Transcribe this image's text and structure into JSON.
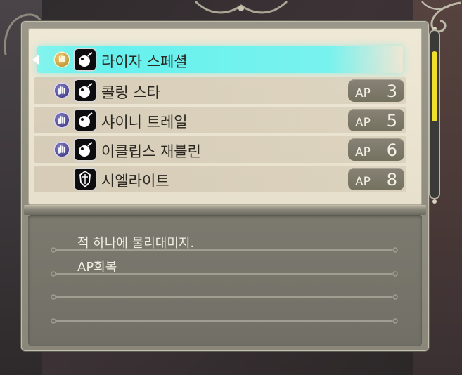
{
  "skills": [
    {
      "type": "fist",
      "type_icon": "fist-icon",
      "icon": "bomb-icon",
      "name": "라이자 스페셜",
      "ap_label": "",
      "ap": "",
      "selected": true
    },
    {
      "type": "magic",
      "type_icon": "magic-hand-icon",
      "icon": "bomb-icon",
      "name": "콜링 스타",
      "ap_label": "AP",
      "ap": "3",
      "selected": false
    },
    {
      "type": "magic",
      "type_icon": "magic-hand-icon",
      "icon": "bomb-icon",
      "name": "샤이니 트레일",
      "ap_label": "AP",
      "ap": "5",
      "selected": false
    },
    {
      "type": "magic",
      "type_icon": "magic-hand-icon",
      "icon": "bomb-icon",
      "name": "이클립스 재블린",
      "ap_label": "AP",
      "ap": "6",
      "selected": false
    },
    {
      "type": "none",
      "type_icon": "",
      "icon": "armor-icon",
      "name": "시엘라이트",
      "ap_label": "AP",
      "ap": "8",
      "selected": false
    }
  ],
  "description": {
    "lines": [
      "적 하나에 물리대미지.",
      "AP회복"
    ]
  },
  "scroll": {
    "position": 0.15,
    "size": 0.42
  },
  "colors": {
    "selection": "#66f1ee",
    "scroll_thumb": "#f0df2c",
    "ap_badge": "#7f7a6c"
  }
}
